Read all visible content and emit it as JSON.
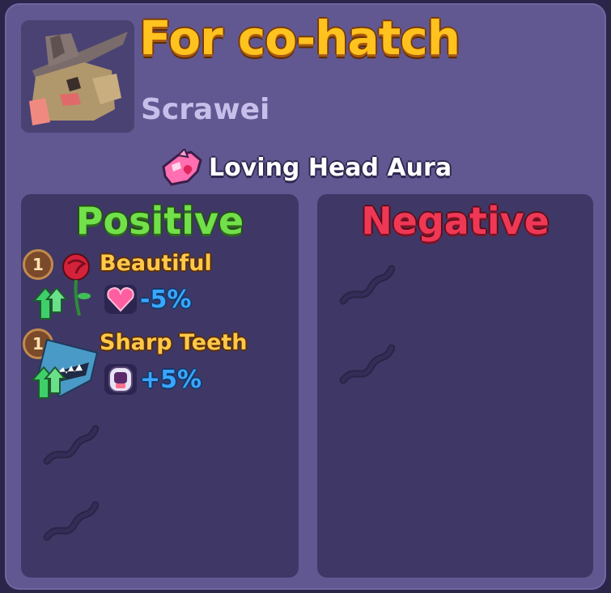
{
  "pet": {
    "name": "For co-hatch",
    "owner": "Scrawei",
    "avatar_icon": "cowboy-pet-icon"
  },
  "aura": {
    "label": "Loving Head Aura",
    "icon": "loving-head-aura-icon"
  },
  "positive": {
    "header": "Positive",
    "traits": [
      {
        "level": "1",
        "name": "Beautiful",
        "icon": "rose-icon",
        "stat_icon": "heart-gem-icon",
        "value": "-5%"
      },
      {
        "level": "1",
        "name": "Sharp Teeth",
        "icon": "shark-teeth-icon",
        "stat_icon": "bite-icon",
        "value": "+5%"
      }
    ],
    "empty_slot_icon": "dna-icon"
  },
  "negative": {
    "header": "Negative",
    "empty_slot_icon": "dna-icon"
  },
  "colors": {
    "panel": "#615891",
    "column": "#3f3866",
    "title": "#ffc21f",
    "positive": "#72e04a",
    "negative": "#ef3855",
    "stat": "#3aa6ff"
  }
}
